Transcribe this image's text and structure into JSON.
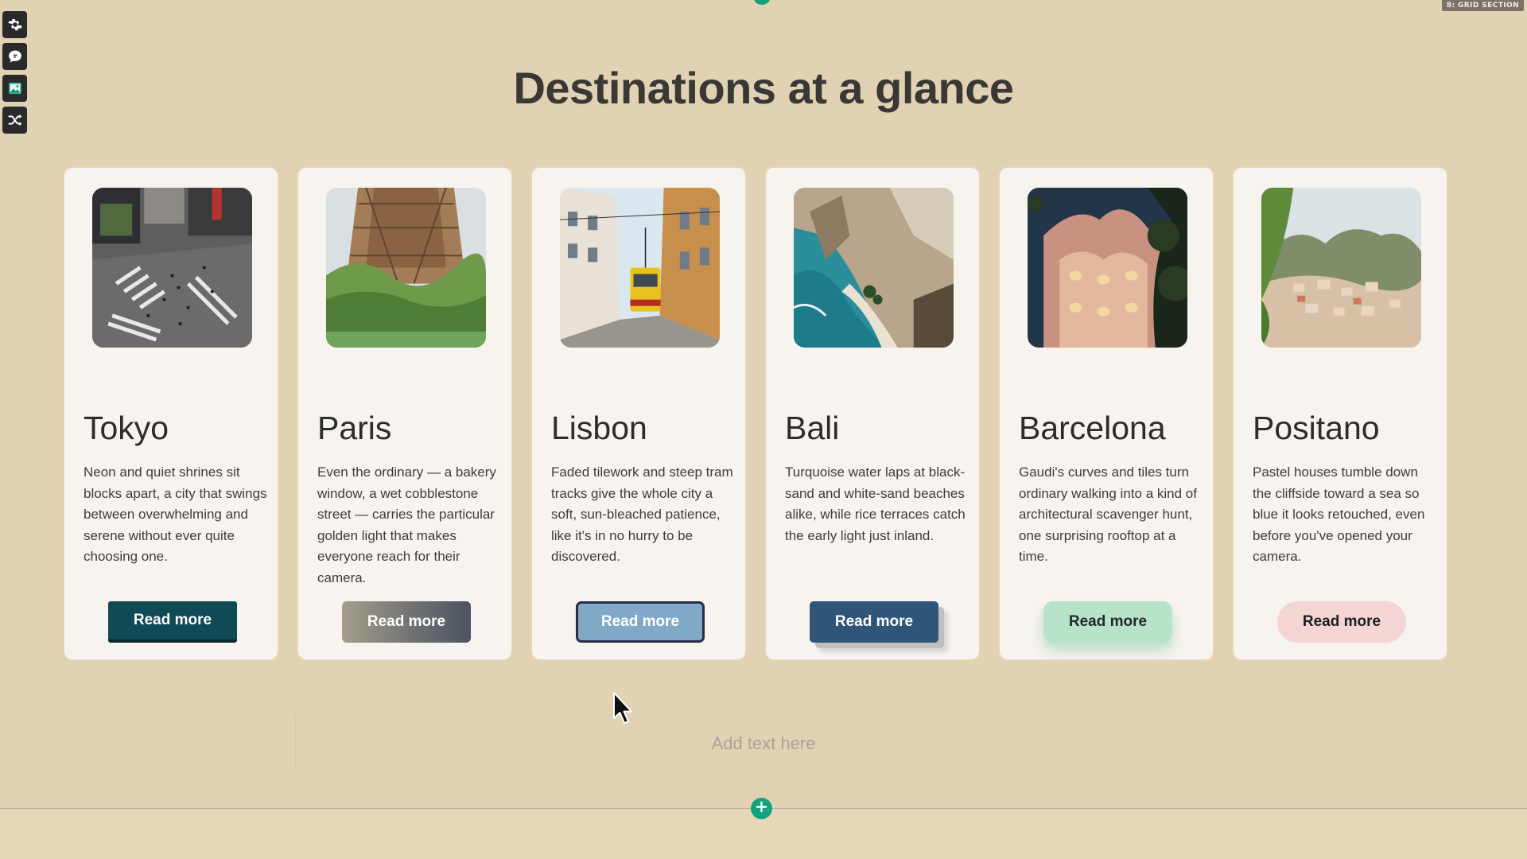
{
  "section_badge": "8: GRID SECTION",
  "toolbar": {
    "tools": [
      {
        "icon": "gear-icon"
      },
      {
        "icon": "speech-bubble-icon"
      },
      {
        "icon": "image-icon"
      },
      {
        "icon": "shuffle-icon"
      }
    ]
  },
  "heading": "Destinations at a glance",
  "cards": [
    {
      "title": "Tokyo",
      "description": "Neon and quiet shrines sit blocks apart, a city that swings between overwhelming and serene without ever quite choosing one.",
      "button": "Read more"
    },
    {
      "title": "Paris",
      "description": "Even the ordinary — a bakery window, a wet cobblestone street — carries the particular golden light that makes everyone reach for their camera.",
      "button": "Read more"
    },
    {
      "title": "Lisbon",
      "description": "Faded tilework and steep tram tracks give the whole city a soft, sun-bleached patience, like it's in no hurry to be discovered.",
      "button": "Read more"
    },
    {
      "title": "Bali",
      "description": "Turquoise water laps at black-sand and white-sand beaches alike, while rice terraces catch the early light just inland.",
      "button": "Read more"
    },
    {
      "title": "Barcelona",
      "description": "Gaudi's curves and tiles turn ordinary walking into a kind of architectural scavenger hunt, one surprising rooftop at a time.",
      "button": "Read more"
    },
    {
      "title": "Positano",
      "description": "Pastel houses tumble down the cliffside toward a sea so blue it looks retouched, even before you've opened your camera.",
      "button": "Read more"
    }
  ],
  "add_text_placeholder": "Add text here",
  "colors": {
    "background": "#e2d2b4",
    "card": "#f7f4ef",
    "accent_green": "#17a27a"
  }
}
